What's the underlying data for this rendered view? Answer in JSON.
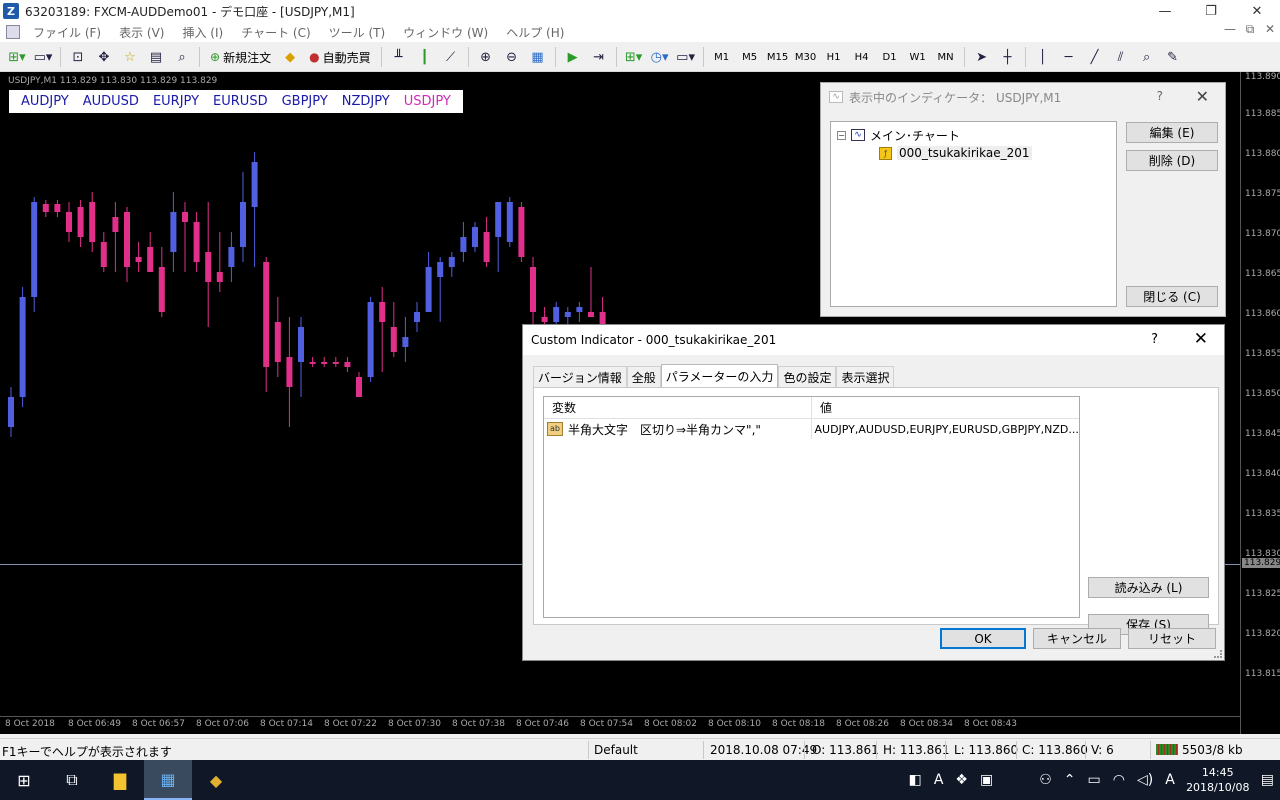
{
  "window": {
    "title": "63203189: FXCM-AUDDemo01 - デモ口座 - [USDJPY,M1]",
    "app_icon": "Z",
    "minimize": "—",
    "restore": "❐",
    "close": "✕"
  },
  "menu": {
    "items": [
      "ファイル (F)",
      "表示 (V)",
      "挿入 (I)",
      "チャート (C)",
      "ツール (T)",
      "ウィンドウ (W)",
      "ヘルプ (H)"
    ],
    "right": [
      "—",
      "⧉",
      "✕"
    ]
  },
  "toolbar": {
    "new_order": "新規注文",
    "auto_trade": "自動売買",
    "timeframes": [
      "M1",
      "M5",
      "M15",
      "M30",
      "H1",
      "H4",
      "D1",
      "W1",
      "MN"
    ]
  },
  "chart": {
    "info": "USDJPY,M1  113.829 113.830 113.829 113.829",
    "symbols": [
      "AUDJPY",
      "AUDUSD",
      "EURJPY",
      "EURUSD",
      "GBPJPY",
      "NZDJPY",
      "USDJPY"
    ],
    "active_symbol": "USDJPY",
    "price_labels": [
      "113.890",
      "113.885",
      "113.880",
      "113.875",
      "113.870",
      "113.865",
      "113.860",
      "113.855",
      "113.850",
      "113.845",
      "113.840",
      "113.835",
      "113.830",
      "113.829",
      "113.825",
      "113.820",
      "113.815"
    ],
    "current_price": "113.829",
    "time_labels": [
      "8 Oct 2018",
      "8 Oct 06:49",
      "8 Oct 06:57",
      "8 Oct 07:06",
      "8 Oct 07:14",
      "8 Oct 07:22",
      "8 Oct 07:30",
      "8 Oct 07:38",
      "8 Oct 07:46",
      "8 Oct 07:54",
      "8 Oct 08:02",
      "8 Oct 08:10",
      "8 Oct 08:18",
      "8 Oct 08:26",
      "8 Oct 08:34",
      "8 Oct 08:43"
    ],
    "bull_color": "#5060e0",
    "bear_color": "#e0308a"
  },
  "indicators_window": {
    "title": "表示中のインディケータ： USDJPY,M1",
    "help": "?",
    "close": "✕",
    "tree_root": "メイン･チャート",
    "tree_child": "000_tsukakirikae_201",
    "edit_button": "編集 (E)",
    "delete_button": "削除 (D)",
    "close_button": "閉じる (C)"
  },
  "custom_indicator": {
    "title": "Custom Indicator - 000_tsukakirikae_201",
    "help": "?",
    "close": "✕",
    "tabs": [
      "バージョン情報",
      "全般",
      "パラメーターの入力",
      "色の設定",
      "表示選択"
    ],
    "active_tab": "パラメーターの入力",
    "col_variable": "変数",
    "col_value": "値",
    "params": [
      {
        "icon": "ab",
        "name": "半角大文字　区切り⇒半角カンマ\",\"",
        "value": "AUDJPY,AUDUSD,EURJPY,EURUSD,GBPJPY,NZD..."
      }
    ],
    "load_button": "読み込み (L)",
    "save_button": "保存 (S)",
    "ok_button": "OK",
    "cancel_button": "キャンセル",
    "reset_button": "リセット"
  },
  "status": {
    "help_text": "F1キーでヘルプが表示されます",
    "profile": "Default",
    "datetime": "2018.10.08 07:49",
    "open": "O: 113.861",
    "high": "H: 113.861",
    "low": "L: 113.860",
    "close": "C: 113.860",
    "volume": "V: 6",
    "traffic": "5503/8 kb"
  },
  "taskbar": {
    "clock_time": "14:45",
    "clock_date": "2018/10/08",
    "ime": "A"
  }
}
